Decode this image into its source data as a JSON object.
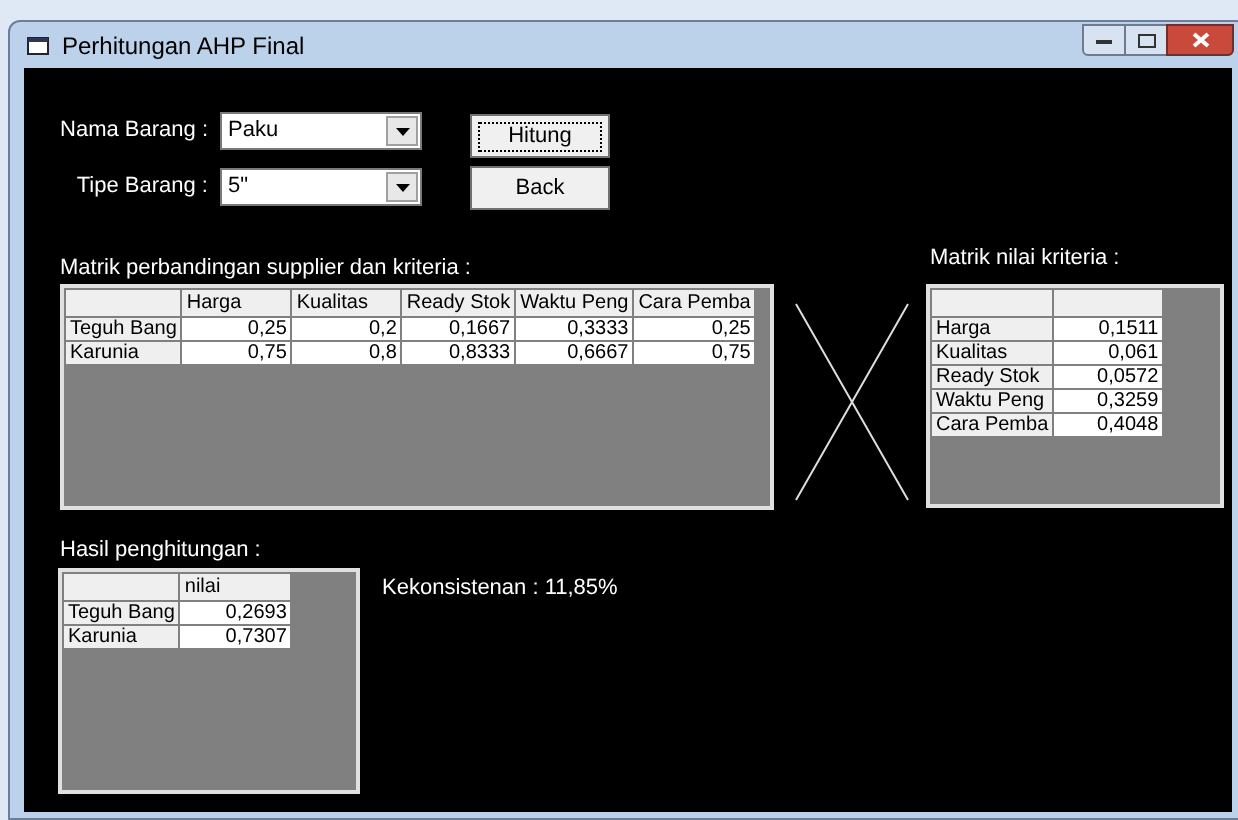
{
  "window": {
    "title": "Perhitungan AHP Final"
  },
  "fields": [
    {
      "label": "Nama Barang :",
      "value": "Paku"
    },
    {
      "label": "Tipe Barang :",
      "value": "5\""
    }
  ],
  "buttons": [
    {
      "label": "Hitung",
      "focused": true
    },
    {
      "label": "Back",
      "focused": false
    }
  ],
  "comparison_matrix": {
    "title": "Matrik perbandingan supplier dan kriteria :",
    "columns": [
      "Harga",
      "Kualitas",
      "Ready Stok",
      "Waktu Peng",
      "Cara Pemba"
    ],
    "rows": [
      {
        "name": "Teguh Bang",
        "values": [
          "0,25",
          "0,2",
          "0,1667",
          "0,3333",
          "0,25"
        ]
      },
      {
        "name": "Karunia",
        "values": [
          "0,75",
          "0,8",
          "0,8333",
          "0,6667",
          "0,75"
        ]
      }
    ]
  },
  "criteria_matrix": {
    "title": "Matrik nilai kriteria :",
    "rows": [
      {
        "name": "Harga",
        "value": "0,1511"
      },
      {
        "name": "Kualitas",
        "value": "0,061"
      },
      {
        "name": "Ready Stok",
        "value": "0,0572"
      },
      {
        "name": "Waktu Peng",
        "value": "0,3259"
      },
      {
        "name": "Cara Pemba",
        "value": "0,4048"
      }
    ]
  },
  "result": {
    "title": "Hasil penghitungan :",
    "columns": [
      "nilai"
    ],
    "rows": [
      {
        "name": "Teguh Bang",
        "value": "0,2693"
      },
      {
        "name": "Karunia",
        "value": "0,7307"
      }
    ]
  },
  "consistency": "Kekonsistenan : 11,85%"
}
